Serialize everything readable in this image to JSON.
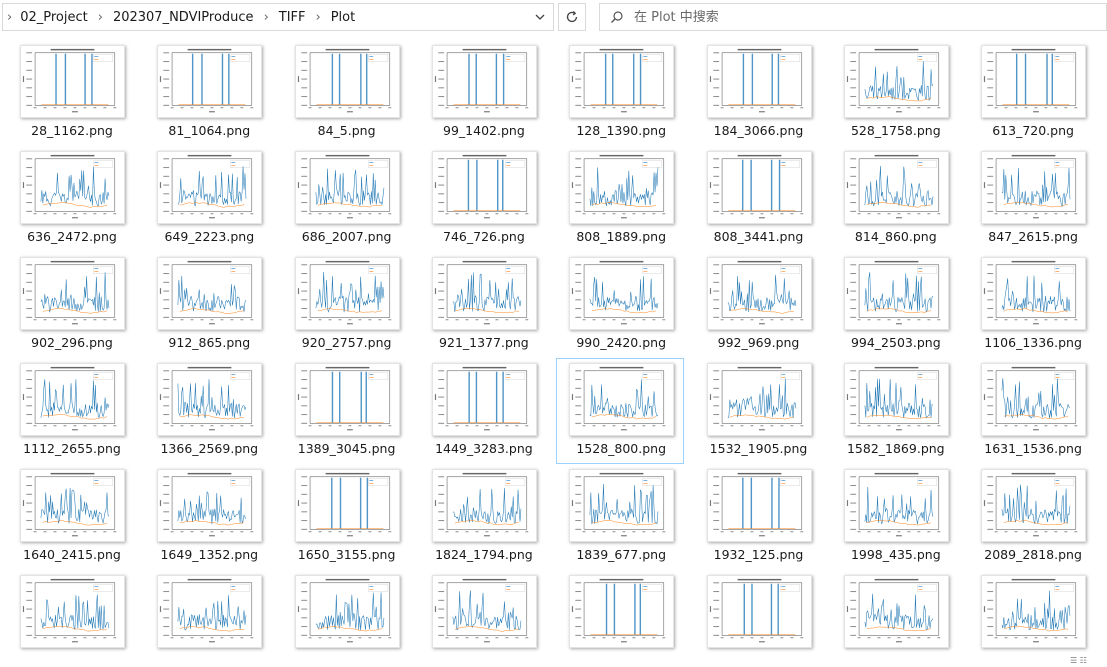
{
  "breadcrumb": [
    "02_Project",
    "202307_NDVIProduce",
    "TIFF",
    "Plot"
  ],
  "search": {
    "placeholder": "在 Plot 中搜索"
  },
  "status": {
    "corner_text": "☰ ☷"
  },
  "files": [
    {
      "name": "28_1162.png",
      "kind": "bars"
    },
    {
      "name": "81_1064.png",
      "kind": "bars"
    },
    {
      "name": "84_5.png",
      "kind": "bars"
    },
    {
      "name": "99_1402.png",
      "kind": "bars"
    },
    {
      "name": "128_1390.png",
      "kind": "bars"
    },
    {
      "name": "184_3066.png",
      "kind": "bars"
    },
    {
      "name": "528_1758.png",
      "kind": "series"
    },
    {
      "name": "613_720.png",
      "kind": "bars"
    },
    {
      "name": "636_2472.png",
      "kind": "series"
    },
    {
      "name": "649_2223.png",
      "kind": "series"
    },
    {
      "name": "686_2007.png",
      "kind": "series"
    },
    {
      "name": "746_726.png",
      "kind": "bars"
    },
    {
      "name": "808_1889.png",
      "kind": "series"
    },
    {
      "name": "808_3441.png",
      "kind": "bars"
    },
    {
      "name": "814_860.png",
      "kind": "series"
    },
    {
      "name": "847_2615.png",
      "kind": "series"
    },
    {
      "name": "902_296.png",
      "kind": "series"
    },
    {
      "name": "912_865.png",
      "kind": "series"
    },
    {
      "name": "920_2757.png",
      "kind": "series"
    },
    {
      "name": "921_1377.png",
      "kind": "series"
    },
    {
      "name": "990_2420.png",
      "kind": "series"
    },
    {
      "name": "992_969.png",
      "kind": "series"
    },
    {
      "name": "994_2503.png",
      "kind": "series"
    },
    {
      "name": "1106_1336.png",
      "kind": "series"
    },
    {
      "name": "1112_2655.png",
      "kind": "series"
    },
    {
      "name": "1366_2569.png",
      "kind": "series"
    },
    {
      "name": "1389_3045.png",
      "kind": "bars"
    },
    {
      "name": "1449_3283.png",
      "kind": "bars"
    },
    {
      "name": "1528_800.png",
      "kind": "series",
      "selected": true
    },
    {
      "name": "1532_1905.png",
      "kind": "series"
    },
    {
      "name": "1582_1869.png",
      "kind": "series"
    },
    {
      "name": "1631_1536.png",
      "kind": "series"
    },
    {
      "name": "1640_2415.png",
      "kind": "series"
    },
    {
      "name": "1649_1352.png",
      "kind": "series"
    },
    {
      "name": "1650_3155.png",
      "kind": "bars"
    },
    {
      "name": "1824_1794.png",
      "kind": "series"
    },
    {
      "name": "1839_677.png",
      "kind": "series"
    },
    {
      "name": "1932_125.png",
      "kind": "bars"
    },
    {
      "name": "1998_435.png",
      "kind": "series"
    },
    {
      "name": "2089_2818.png",
      "kind": "series"
    },
    {
      "name": "",
      "kind": "series"
    },
    {
      "name": "",
      "kind": "series"
    },
    {
      "name": "",
      "kind": "series"
    },
    {
      "name": "",
      "kind": "series"
    },
    {
      "name": "",
      "kind": "bars"
    },
    {
      "name": "",
      "kind": "bars"
    },
    {
      "name": "",
      "kind": "series"
    },
    {
      "name": "",
      "kind": "series"
    }
  ],
  "colors": {
    "line": "#1f77b4",
    "line2": "#ff7f0e",
    "selection": "#99d1ff"
  }
}
